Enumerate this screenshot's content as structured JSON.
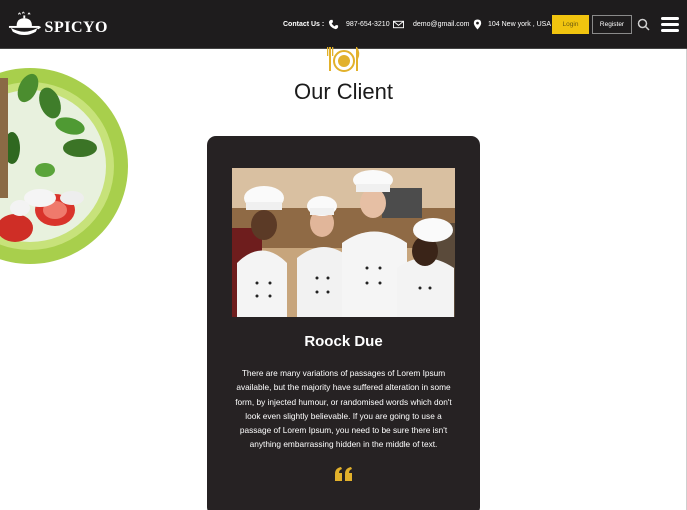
{
  "brand": {
    "name": "SPICYO",
    "logo_icon": "chef-pan-icon"
  },
  "contact": {
    "label": "Contact Us :",
    "phone": "987-654-3210",
    "email": "demo@gmail.com",
    "location": "104 New york , USA"
  },
  "nav": {
    "login_label": "Login",
    "register_label": "Register",
    "search_icon": "search-icon",
    "menu_icon": "hamburger-menu-icon"
  },
  "section": {
    "icon": "plate-cutlery-icon",
    "title": "Our Client"
  },
  "client": {
    "name": "Roock Due",
    "testimonial": "There are many variations of passages of Lorem Ipsum available, but the majority have suffered alteration in some form, by injected humour, or randomised words which don't look even slightly believable. If you are going to use a passage of Lorem Ipsum, you need to be sure there isn't anything embarrassing hidden in the middle of text.",
    "quote_icon": "quote-icon"
  },
  "colors": {
    "navbar": "#1e1c1d",
    "accent": "#f1c40f",
    "card": "#262223"
  }
}
